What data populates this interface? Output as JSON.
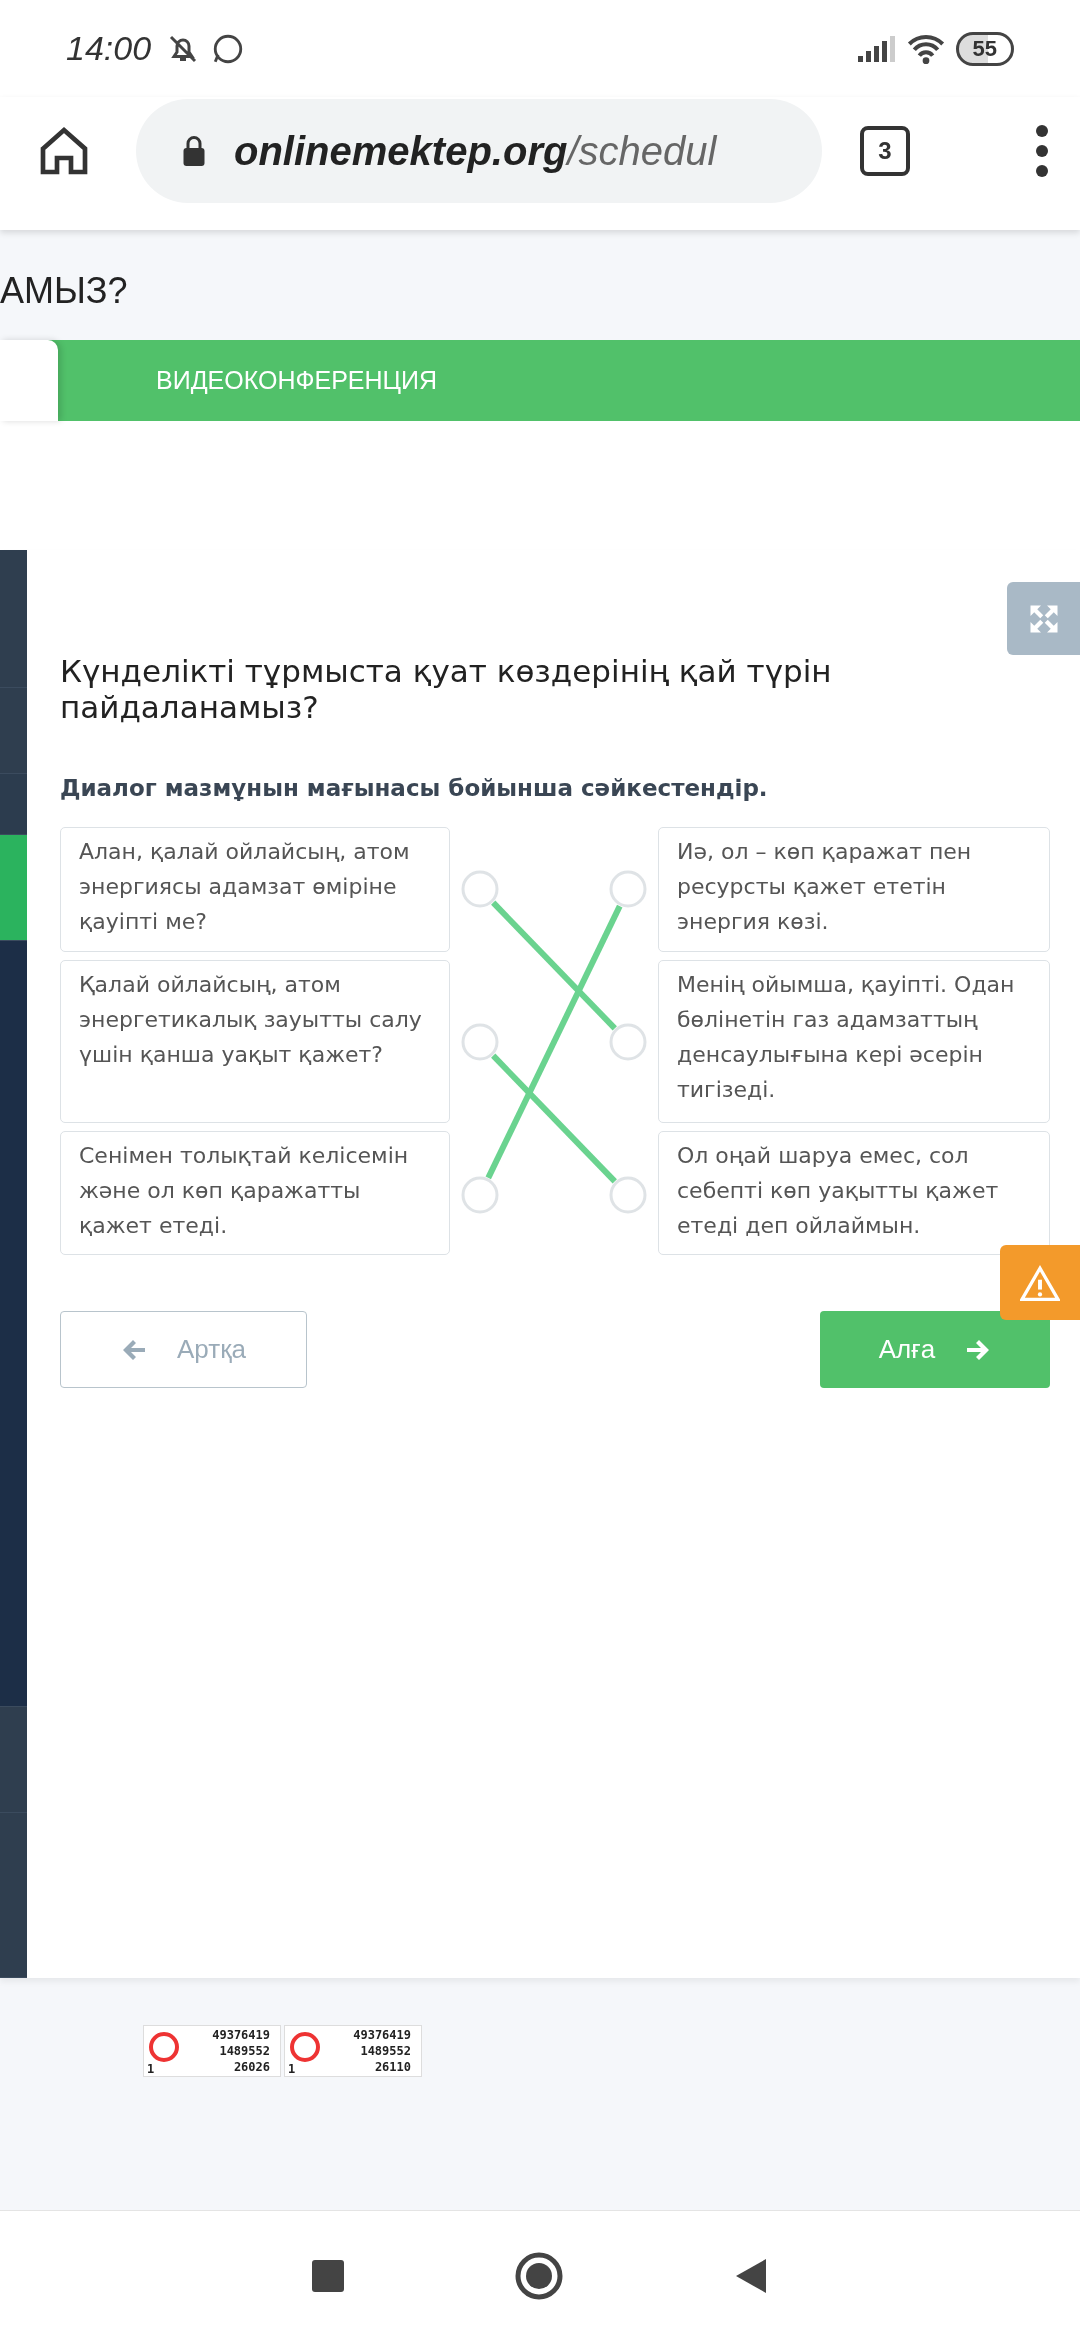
{
  "status_bar": {
    "time": "14:00",
    "battery": "55"
  },
  "browser": {
    "url_host": "onlinemektep.org",
    "url_path": "/schedul",
    "tab_count": "3"
  },
  "header": {
    "title_fragment": "АМЫЗ?",
    "tab_label": "ВИДЕОКОНФЕРЕНЦИЯ"
  },
  "question": {
    "title": "Күнделікті тұрмыста қуат көздерінің қай түрін пайдаланамыз?",
    "instruction": "Диалог мазмұнын мағынасы бойынша сәйкестендір."
  },
  "left_items": [
    {
      "text": "Алан, қалай ойлайсың, атом энергиясы адамзат өміріне қауіпті ме?",
      "links": [
        false,
        true,
        false
      ]
    },
    {
      "text": "Қалай ойлайсың, атом энергетикалық зауытты салу үшін қанша уақыт қажет?",
      "links": [
        false,
        false,
        true
      ]
    },
    {
      "text": "Сенімен толықтай келісемін және ол көп қаражатты қажет етеді.",
      "links": [
        true,
        false,
        false
      ]
    }
  ],
  "right_items": [
    {
      "text": "Иә, ол – көп қаражат пен ресурсты қажет ететін энергия көзі."
    },
    {
      "text": "Менің ойымша, қауіпті. Одан бөлінетін газ адамзаттың денсаулығына кері әсерін тигізеді."
    },
    {
      "text": "Ол оңай шаруа емес, сол себепті көп уақытты қажет етеді деп ойлаймын."
    }
  ],
  "buttons": {
    "back": "Артқа",
    "next": "Алға"
  },
  "counters": [
    {
      "lines": [
        "49376419",
        "1489552",
        "26026"
      ],
      "corner": "1"
    },
    {
      "lines": [
        "49376419",
        "1489552",
        "26110"
      ],
      "corner": "1"
    }
  ]
}
